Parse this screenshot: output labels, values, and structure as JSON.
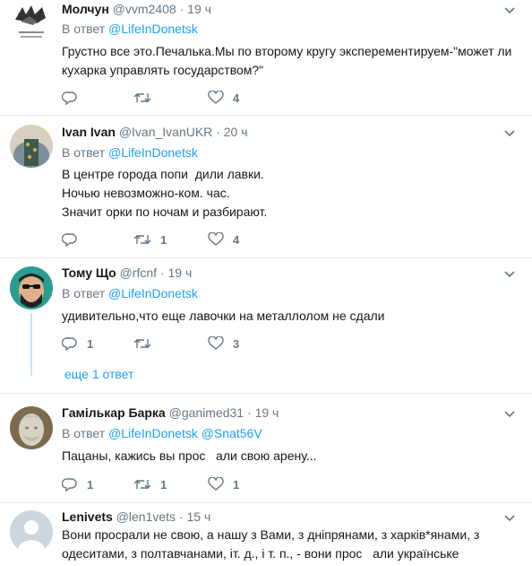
{
  "reply_prefix": "В ответ",
  "tweets": [
    {
      "name": "Молчун",
      "handle": "@vvm2408",
      "time": "19 ч",
      "reply_to": [
        "@LifeInDonetsk"
      ],
      "lines": [
        "Грустно все это.Печалька.Мы по второму кругу эксперементируем-\"может ли",
        "кухарка управлять государством?\""
      ],
      "replies": "",
      "retweets": "",
      "likes": "4"
    },
    {
      "name": "Ivan Ivan",
      "handle": "@Ivan_IvanUKR",
      "time": "20 ч",
      "reply_to": [
        "@LifeInDonetsk"
      ],
      "lines": [
        "В центре города попи  дили лавки.",
        "Ночью невозможно-ком. час.",
        "Значит орки по ночам и разбирают."
      ],
      "replies": "",
      "retweets": "1",
      "likes": "4"
    },
    {
      "name": "Тому Що",
      "handle": "@rfcnf",
      "time": "19 ч",
      "reply_to": [
        "@LifeInDonetsk"
      ],
      "lines": [
        "удивительно,что еще лавочки на металлолом не сдали"
      ],
      "replies": "1",
      "retweets": "",
      "likes": "3"
    },
    {
      "name": "Гамількар Барка",
      "handle": "@ganimed31",
      "time": "19 ч",
      "reply_to": [
        "@LifeInDonetsk",
        "@Snat56V"
      ],
      "lines": [
        "Пацаны, кажись вы прос   али свою арену..."
      ],
      "replies": "1",
      "retweets": "1",
      "likes": "1"
    },
    {
      "name": "Lenivets",
      "handle": "@len1vets",
      "time": "15 ч",
      "reply_to": [],
      "lines": [
        "Вони просрали не свою, а нашу з Вами, з дніпрянами, з харків*янами, з",
        "одеситами, з полтавчанами, іт. д., і т. п., - вони прос   али українське"
      ],
      "replies": "",
      "retweets": "",
      "likes": ""
    }
  ],
  "show_more": "еще 1 ответ",
  "icons": {
    "reply": "reply-icon",
    "retweet": "retweet-icon",
    "like": "heart-icon",
    "caret": "chevron-down-icon"
  },
  "colors": {
    "link": "#1da1f2",
    "muted": "#657786",
    "text": "#14171a",
    "divider": "#e6ecf0",
    "thread": "#c4e5fb"
  }
}
